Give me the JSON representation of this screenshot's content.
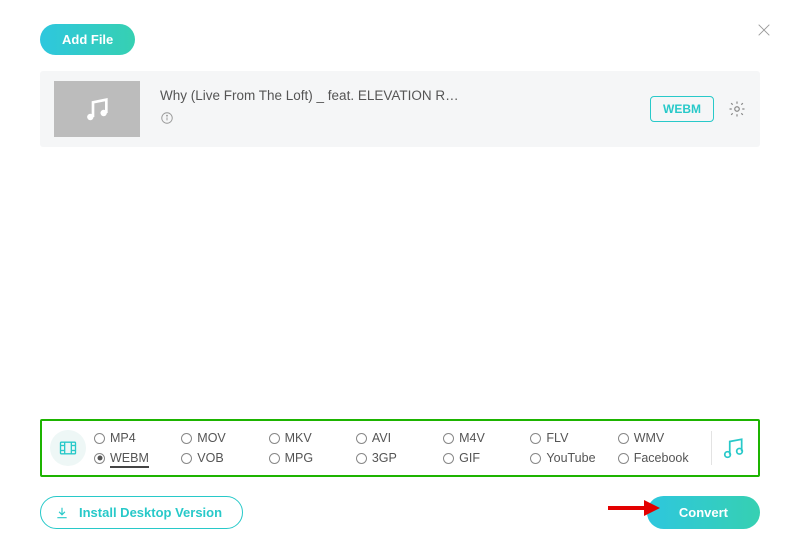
{
  "header": {
    "add_file_label": "Add File"
  },
  "file": {
    "title": "Why (Live From The Loft) _ feat. ELEVATION R…",
    "format_badge": "WEBM"
  },
  "formats": {
    "row1": [
      {
        "key": "mp4",
        "label": "MP4",
        "selected": false
      },
      {
        "key": "mov",
        "label": "MOV",
        "selected": false
      },
      {
        "key": "mkv",
        "label": "MKV",
        "selected": false
      },
      {
        "key": "avi",
        "label": "AVI",
        "selected": false
      },
      {
        "key": "m4v",
        "label": "M4V",
        "selected": false
      },
      {
        "key": "flv",
        "label": "FLV",
        "selected": false
      },
      {
        "key": "wmv",
        "label": "WMV",
        "selected": false
      }
    ],
    "row2": [
      {
        "key": "webm",
        "label": "WEBM",
        "selected": true
      },
      {
        "key": "vob",
        "label": "VOB",
        "selected": false
      },
      {
        "key": "mpg",
        "label": "MPG",
        "selected": false
      },
      {
        "key": "3gp",
        "label": "3GP",
        "selected": false
      },
      {
        "key": "gif",
        "label": "GIF",
        "selected": false
      },
      {
        "key": "youtube",
        "label": "YouTube",
        "selected": false
      },
      {
        "key": "facebook",
        "label": "Facebook",
        "selected": false
      }
    ]
  },
  "footer": {
    "install_label": "Install Desktop Version",
    "convert_label": "Convert"
  },
  "colors": {
    "accent": "#28c9c9",
    "highlight_box": "#1db400",
    "arrow": "#e30000"
  }
}
